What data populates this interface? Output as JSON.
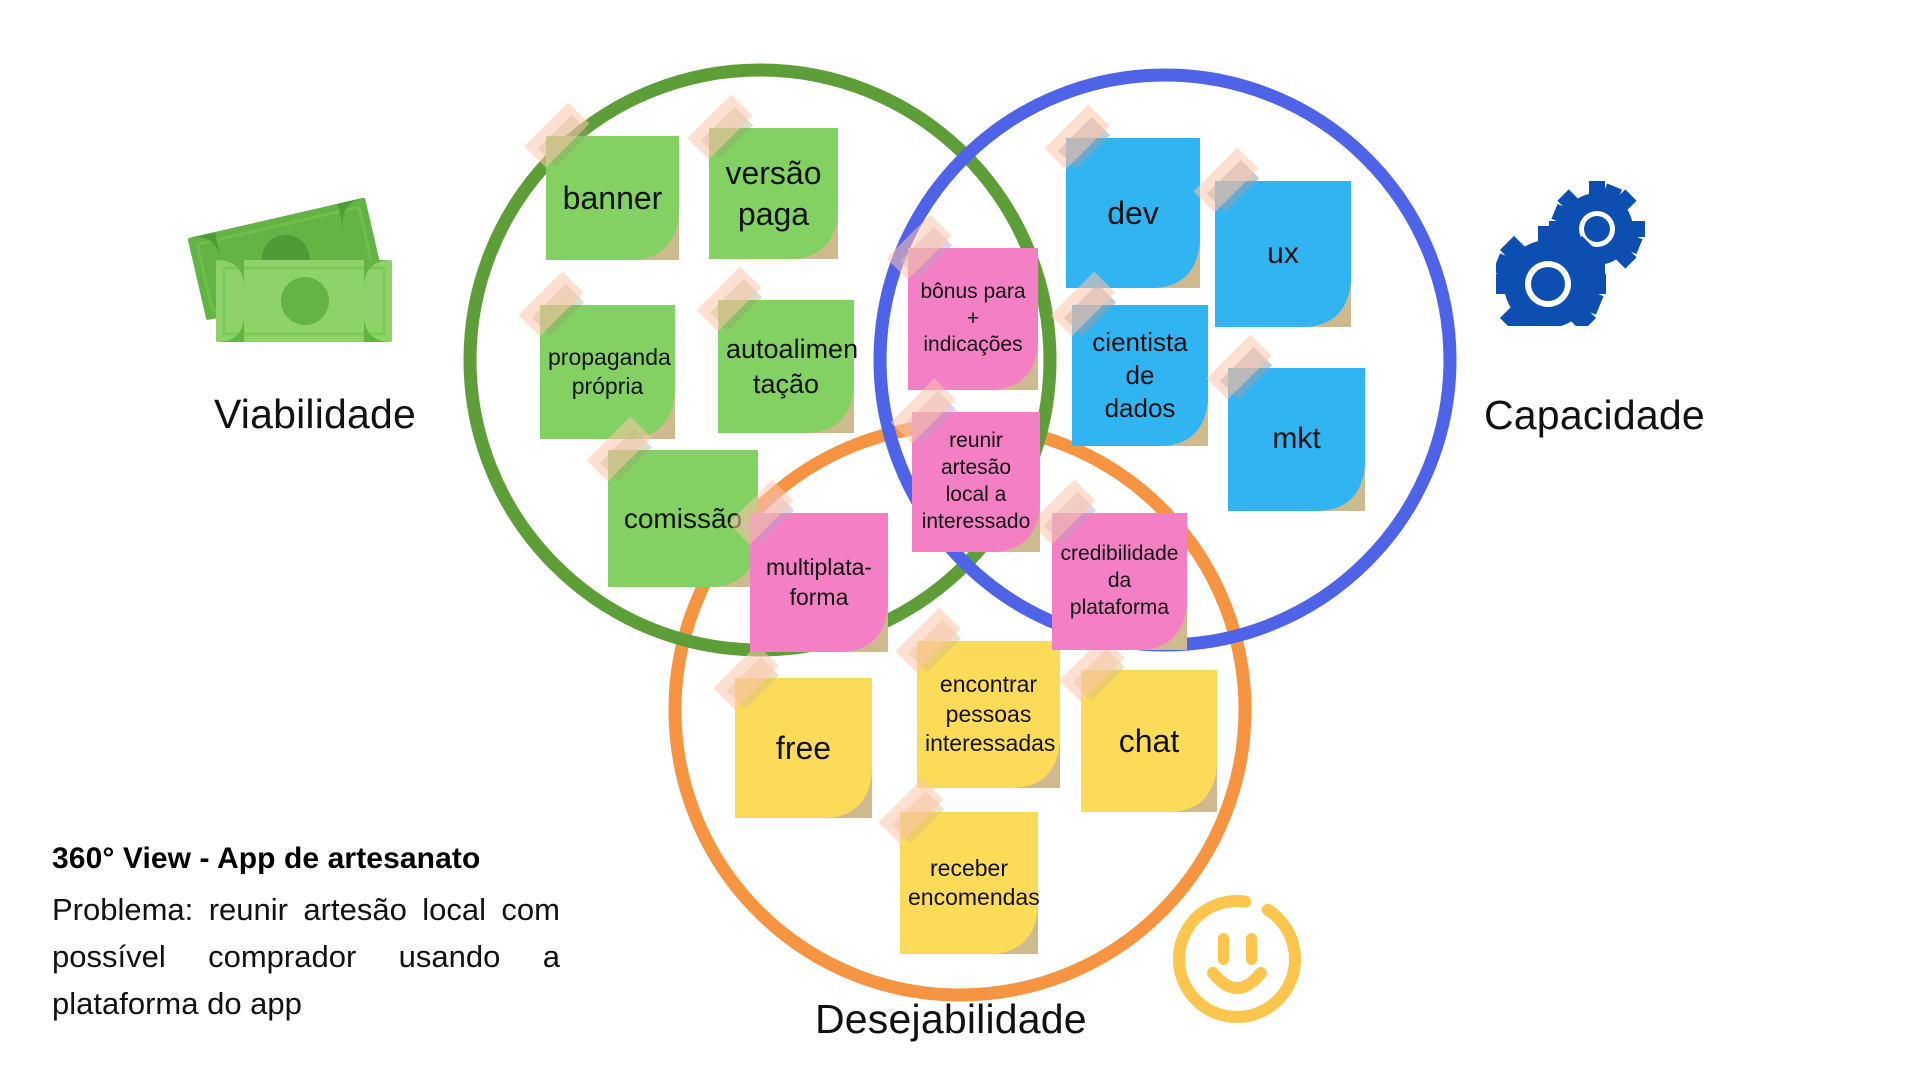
{
  "diagram": {
    "type": "venn-3-circle",
    "title": "360° View - App de artesanato",
    "circles": [
      {
        "id": "viabilidade",
        "label": "Viabilidade",
        "color": "#5d9e39",
        "icon": "money-bills-icon"
      },
      {
        "id": "capacidade",
        "label": "Capacidade",
        "color": "#4f63e8",
        "icon": "gears-icon"
      },
      {
        "id": "desejabilidade",
        "label": "Desejabilidade",
        "color": "#f79441",
        "icon": "smiley-face-icon"
      }
    ]
  },
  "notes": {
    "viabilidade": [
      {
        "id": "banner",
        "text": "banner",
        "color": "#83d162",
        "font_size": 32
      },
      {
        "id": "versao-paga",
        "text": "versão\npaga",
        "color": "#83d162",
        "font_size": 32
      },
      {
        "id": "propaganda-propria",
        "text": "propaganda\nprópria",
        "color": "#83d162",
        "font_size": 23
      },
      {
        "id": "autoalimentacao",
        "text": "autoalimen\ntação",
        "color": "#83d162",
        "font_size": 27
      },
      {
        "id": "comissao",
        "text": "comissão",
        "color": "#83d162",
        "font_size": 28
      }
    ],
    "capacidade": [
      {
        "id": "dev",
        "text": "dev",
        "color": "#31b4f2",
        "font_size": 32
      },
      {
        "id": "ux",
        "text": "ux",
        "color": "#31b4f2",
        "font_size": 30
      },
      {
        "id": "cientista-dados",
        "text": "cientista\nde\ndados",
        "color": "#31b4f2",
        "font_size": 26
      },
      {
        "id": "mkt",
        "text": "mkt",
        "color": "#31b4f2",
        "font_size": 30
      }
    ],
    "desejabilidade": [
      {
        "id": "free",
        "text": "free",
        "color": "#fcdb58",
        "font_size": 32
      },
      {
        "id": "encontrar-pessoas",
        "text": "encontrar\npessoas\ninteressadas",
        "color": "#fcdb58",
        "font_size": 23
      },
      {
        "id": "chat",
        "text": "chat",
        "color": "#fcdb58",
        "font_size": 32
      },
      {
        "id": "receber-encomendas",
        "text": "receber\nencomendas",
        "color": "#fcdb58",
        "font_size": 23
      }
    ],
    "intersections": [
      {
        "id": "bonus-indicacoes",
        "text": "bônus para +\nindicações",
        "color": "#f47fc4",
        "font_size": 21,
        "overlap": "viabilidade+capacidade"
      },
      {
        "id": "reunir-artesao",
        "text": "reunir\nartesão\nlocal a\ninteressado",
        "color": "#f47fc4",
        "font_size": 21,
        "overlap": "viabilidade+capacidade+desejabilidade"
      },
      {
        "id": "multiplataforma",
        "text": "multiplata-\nforma",
        "color": "#f47fc4",
        "font_size": 23,
        "overlap": "viabilidade+desejabilidade"
      },
      {
        "id": "credibilidade",
        "text": "credibilidade\nda\nplataforma",
        "color": "#f47fc4",
        "font_size": 21,
        "overlap": "capacidade+desejabilidade"
      }
    ]
  },
  "caption": {
    "title": "360° View - App de artesanato",
    "body": "Problema: reunir artesão local com possível comprador usando a plataforma do app"
  },
  "colors": {
    "circle_green": "#5d9e39",
    "circle_blue": "#4f63e8",
    "circle_orange": "#f79441",
    "note_green": "#83d162",
    "note_blue": "#31b4f2",
    "note_pink": "#f47fc4",
    "note_yellow": "#fcdb58",
    "fold": "#cfb98e",
    "money_icon": "#63b445",
    "gears_icon": "#0d4fb0",
    "smiley_icon": "#fcc54e",
    "text": "#111111",
    "background": "#ffffff"
  }
}
